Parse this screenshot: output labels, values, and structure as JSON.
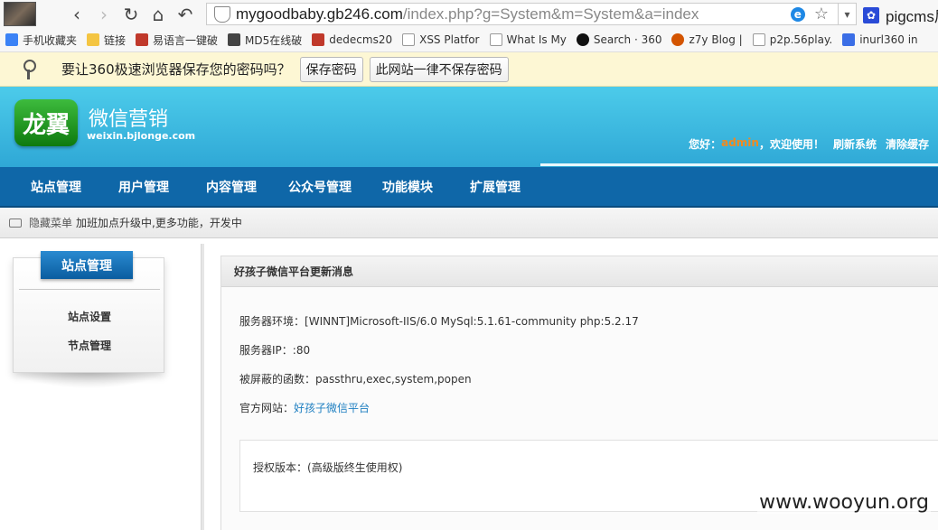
{
  "browser": {
    "url_host": "mygoodbaby.gb246.com",
    "url_path": "/index.php?g=System&m=System&a=index",
    "tab_preview": "pigcms后",
    "icons": [
      "avatar",
      "back-icon",
      "forward-icon",
      "reload-icon",
      "home-icon",
      "undo-icon",
      "shield-icon",
      "ie-icon",
      "star-icon",
      "chevron-down-icon",
      "paw-icon"
    ]
  },
  "bookmarks": [
    {
      "label": "手机收藏夹",
      "icon": "phone"
    },
    {
      "label": "链接",
      "icon": "folder"
    },
    {
      "label": "易语言一键破",
      "icon": "red"
    },
    {
      "label": "MD5在线破",
      "icon": "dark"
    },
    {
      "label": "dedecms20",
      "icon": "red"
    },
    {
      "label": "XSS Platfor",
      "icon": "doc"
    },
    {
      "label": "What Is My",
      "icon": "doc"
    },
    {
      "label": "Search · 360",
      "icon": "gh"
    },
    {
      "label": "z7y Blog |",
      "icon": "bug"
    },
    {
      "label": "p2p.56play.",
      "icon": "doc"
    },
    {
      "label": "inurl360 in",
      "icon": "g"
    }
  ],
  "password_prompt": {
    "text": "要让360极速浏览器保存您的密码吗？",
    "save_label": "保存密码",
    "never_label": "此网站一律不保存密码"
  },
  "site": {
    "logo_text": "龙翼",
    "title": "微信营销",
    "subtitle": "weixin.bjlonge.com",
    "greeting_prefix": "您好：",
    "username": "admin",
    "greeting_suffix": "，欢迎使用！",
    "refresh_label": "刷新系统",
    "clear_cache_label": "清除缓存"
  },
  "nav": [
    {
      "label": "站点管理"
    },
    {
      "label": "用户管理"
    },
    {
      "label": "内容管理"
    },
    {
      "label": "公众号管理"
    },
    {
      "label": "功能模块"
    },
    {
      "label": "扩展管理"
    }
  ],
  "notice": {
    "hide_label": "隐藏菜单",
    "text": "加班加点升级中,更多功能，开发中"
  },
  "sidebar": {
    "title": "站点管理",
    "items": [
      {
        "label": "站点设置"
      },
      {
        "label": "节点管理"
      }
    ]
  },
  "panel": {
    "title": "好孩子微信平台更新消息",
    "server_env_label": "服务器环境：",
    "server_env_value": "[WINNT]Microsoft-IIS/6.0 MySql:5.1.61-community php:5.2.17",
    "server_ip_label": "服务器IP：",
    "server_ip_value": ":80",
    "disabled_funcs_label": "被屏蔽的函数：",
    "disabled_funcs_value": "passthru,exec,system,popen",
    "website_label": "官方网站：",
    "website_link": "好孩子微信平台",
    "license_label": "授权版本：",
    "license_value": "(高级版终生使用权)"
  },
  "watermark": "www.wooyun.org"
}
